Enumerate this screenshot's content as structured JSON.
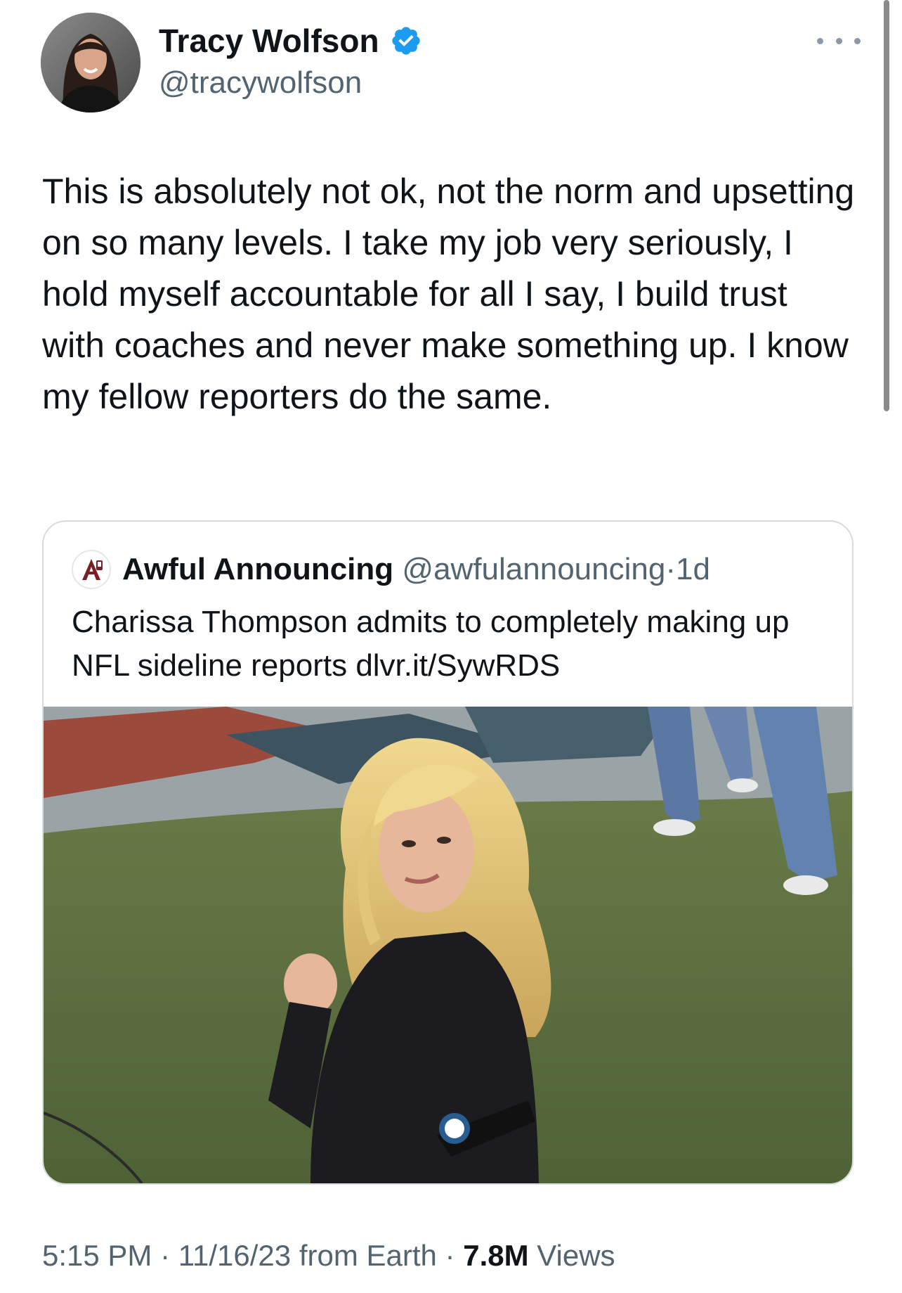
{
  "tweet": {
    "author": {
      "name": "Tracy Wolfson",
      "handle": "@tracywolfson",
      "verified": true,
      "avatar_icon": "profile-photo"
    },
    "text": "This is absolutely not ok, not the norm and upsetting on so many levels. I take my job very seriously, I hold myself accountable for all I say, I build trust with coaches and never make something up. I know my fellow reporters do the same.",
    "more_icon": "ellipsis-icon",
    "quote": {
      "author_name": "Awful Announcing",
      "author_handle": "@awfulannouncing",
      "separator": "·",
      "age": "1d",
      "text": "Charissa Thompson admits to completely making up NFL sideline reports dlvr.it/SywRDS",
      "image_icon": "photo-sideline-reporter"
    },
    "meta": {
      "time": "5:15 PM",
      "separator": "·",
      "date": "11/16/23",
      "source": "from Earth",
      "views_count": "7.8M",
      "views_label": "Views"
    }
  },
  "colors": {
    "text_primary": "#0f1419",
    "text_secondary": "#536471",
    "verified_blue": "#1d9bf0",
    "card_border": "#d6dbdf"
  }
}
